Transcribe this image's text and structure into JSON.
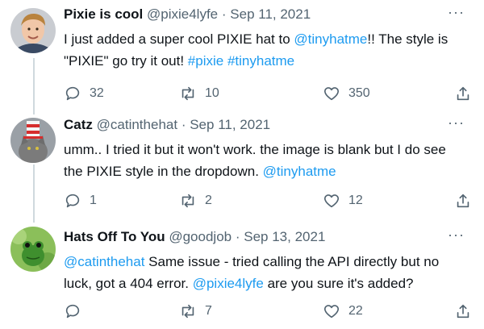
{
  "tweets": [
    {
      "name": "Pixie is cool",
      "handle": "@pixie4lyfe",
      "sep": "·",
      "date": "Sep 11, 2021",
      "more": "···",
      "lines": [
        [
          {
            "t": "I just added a super cool PIXIE hat to "
          },
          {
            "t": "@tinyhatme",
            "link": true
          },
          {
            "t": "!! The style is"
          }
        ],
        [
          {
            "t": "\"PIXIE\" go try it out! "
          },
          {
            "t": "#pixie",
            "link": true
          },
          {
            "t": " "
          },
          {
            "t": "#tinyhatme",
            "link": true
          }
        ]
      ],
      "replies": "32",
      "retweets": "10",
      "likes": "350"
    },
    {
      "name": "Catz",
      "handle": "@catinthehat",
      "sep": "·",
      "date": "Sep 11, 2021",
      "more": "···",
      "lines": [
        [
          {
            "t": "umm.. I tried it but it won't work. the image is blank but I do see"
          }
        ],
        [
          {
            "t": "the PIXIE style in the dropdown. "
          },
          {
            "t": "@tinyhatme",
            "link": true
          }
        ]
      ],
      "replies": "1",
      "retweets": "2",
      "likes": "12"
    },
    {
      "name": "Hats Off To You",
      "handle": "@goodjob",
      "sep": "·",
      "date": "Sep 13, 2021",
      "more": "···",
      "lines": [
        [
          {
            "t": "@catinthehat",
            "link": true
          },
          {
            "t": " Same issue - tried calling the API directly but no"
          }
        ],
        [
          {
            "t": "luck, got a 404 error. "
          },
          {
            "t": "@pixie4lyfe",
            "link": true
          },
          {
            "t": " are you sure it's added?"
          }
        ]
      ],
      "replies": "",
      "retweets": "7",
      "likes": "22"
    }
  ],
  "icons": {
    "reply": "reply-icon",
    "retweet": "retweet-icon",
    "like": "heart-icon",
    "share": "share-icon"
  },
  "colors": {
    "link": "#1d9bf0",
    "secondary_text": "#536471",
    "thread_line": "#cfd9de"
  }
}
